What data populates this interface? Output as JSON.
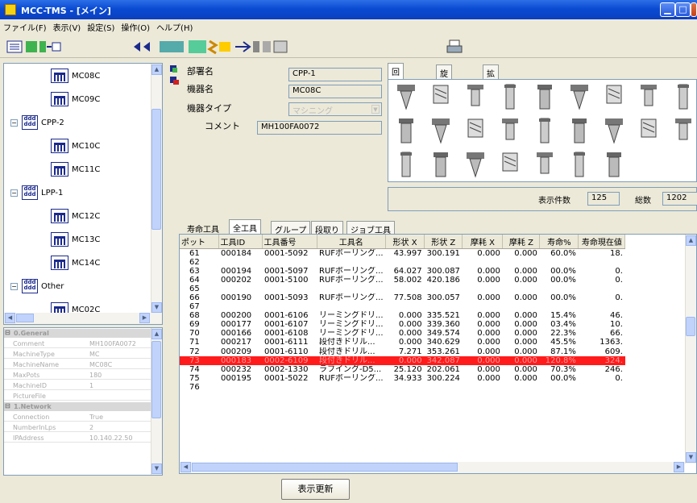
{
  "window": {
    "title": "MCC-TMS - [メイン]"
  },
  "menu": [
    "ファイル(F)",
    "表示(V)",
    "設定(S)",
    "操作(O)",
    "ヘルプ(H)"
  ],
  "tree": {
    "items": [
      {
        "type": "machine",
        "label": "MC08C",
        "indent": 2
      },
      {
        "type": "machine",
        "label": "MC09C",
        "indent": 2
      },
      {
        "type": "group",
        "label": "CPP-2",
        "indent": 1
      },
      {
        "type": "machine",
        "label": "MC10C",
        "indent": 2
      },
      {
        "type": "machine",
        "label": "MC11C",
        "indent": 2
      },
      {
        "type": "group",
        "label": "LPP-1",
        "indent": 1
      },
      {
        "type": "machine",
        "label": "MC12C",
        "indent": 2
      },
      {
        "type": "machine",
        "label": "MC13C",
        "indent": 2
      },
      {
        "type": "machine",
        "label": "MC14C",
        "indent": 2
      },
      {
        "type": "group",
        "label": "Other",
        "indent": 1
      },
      {
        "type": "machine",
        "label": "MC02C",
        "indent": 2
      }
    ]
  },
  "properties": {
    "categories": [
      {
        "name": "0.General",
        "rows": [
          [
            "Comment",
            "MH100FA0072"
          ],
          [
            "MachineType",
            "MC"
          ],
          [
            "MachineName",
            "MC08C"
          ],
          [
            "MaxPots",
            "180"
          ],
          [
            "MachineID",
            "1"
          ],
          [
            "PictureFile",
            ""
          ]
        ]
      },
      {
        "name": "1.Network",
        "rows": [
          [
            "Connection",
            "True"
          ],
          [
            "NumberInLps",
            "2"
          ],
          [
            "IPAddress",
            "10.140.22.50"
          ]
        ]
      }
    ]
  },
  "info": {
    "dept_label": "部署名",
    "dept_value": "CPP-1",
    "machine_label": "機器名",
    "machine_value": "MC08C",
    "type_label": "機器タイプ",
    "type_value": "マシニング",
    "comment_label": "コメント",
    "comment_value": "MH100FA0072"
  },
  "tool_tabs": [
    "回転工具",
    "旋削工具",
    "拡張検索"
  ],
  "counts": {
    "shown_label": "表示件数",
    "shown_value": "125",
    "total_label": "総数",
    "total_value": "1202"
  },
  "grid_tabs": [
    "寿命工具",
    "全工具",
    "グループ",
    "段取り",
    "ジョブ工具"
  ],
  "grid": {
    "columns": [
      "ポット",
      "工具ID",
      "工具番号",
      "工具名",
      "形状 X",
      "形状 Z",
      "摩耗 X",
      "摩耗 Z",
      "寿命%",
      "寿命現在値"
    ],
    "rows": [
      [
        "61",
        "000184",
        "0001-5092",
        "RUFボーリング...",
        "43.997",
        "300.191",
        "0.000",
        "0.000",
        "60.0%",
        "18."
      ],
      [
        "62",
        "",
        "",
        "",
        "",
        "",
        "",
        "",
        "",
        ""
      ],
      [
        "63",
        "000194",
        "0001-5097",
        "RUFボーリング...",
        "64.027",
        "300.087",
        "0.000",
        "0.000",
        "00.0%",
        "0."
      ],
      [
        "64",
        "000202",
        "0001-5100",
        "RUFボーリング...",
        "58.002",
        "420.186",
        "0.000",
        "0.000",
        "00.0%",
        "0."
      ],
      [
        "65",
        "",
        "",
        "",
        "",
        "",
        "",
        "",
        "",
        ""
      ],
      [
        "66",
        "000190",
        "0001-5093",
        "RUFボーリング...",
        "77.508",
        "300.057",
        "0.000",
        "0.000",
        "00.0%",
        "0."
      ],
      [
        "67",
        "",
        "",
        "",
        "",
        "",
        "",
        "",
        "",
        ""
      ],
      [
        "68",
        "000200",
        "0001-6106",
        "リーミングドリ...",
        "0.000",
        "335.521",
        "0.000",
        "0.000",
        "15.4%",
        "46."
      ],
      [
        "69",
        "000177",
        "0001-6107",
        "リーミングドリ...",
        "0.000",
        "339.360",
        "0.000",
        "0.000",
        "03.4%",
        "10."
      ],
      [
        "70",
        "000166",
        "0001-6108",
        "リーミングドリ...",
        "0.000",
        "349.574",
        "0.000",
        "0.000",
        "22.3%",
        "66."
      ],
      [
        "71",
        "000217",
        "0001-6111",
        "段付きドリル...",
        "0.000",
        "340.629",
        "0.000",
        "0.000",
        "45.5%",
        "1363."
      ],
      [
        "72",
        "000209",
        "0001-6110",
        "段付きドリル...",
        "7.271",
        "353.261",
        "0.000",
        "0.000",
        "87.1%",
        "609."
      ],
      [
        "73",
        "000183",
        "0002-6109",
        "段付きドリル...",
        "0.000",
        "342.087",
        "0.000",
        "0.000",
        "120.8%",
        "324."
      ],
      [
        "74",
        "000232",
        "0002-1330",
        "ラフイング-D5...",
        "25.120",
        "202.061",
        "0.000",
        "0.000",
        "70.3%",
        "246."
      ],
      [
        "75",
        "000195",
        "0001-5022",
        "RUFボーリング...",
        "34.933",
        "300.224",
        "0.000",
        "0.000",
        "00.0%",
        "0."
      ],
      [
        "76",
        "",
        "",
        "",
        "",
        "",
        "",
        "",
        "",
        ""
      ]
    ],
    "highlight_row": 12
  },
  "buttons": {
    "refresh": "表示更新"
  },
  "colors": {
    "highlight": "#ff1b1b",
    "titlebar": "#0a4bd3"
  }
}
